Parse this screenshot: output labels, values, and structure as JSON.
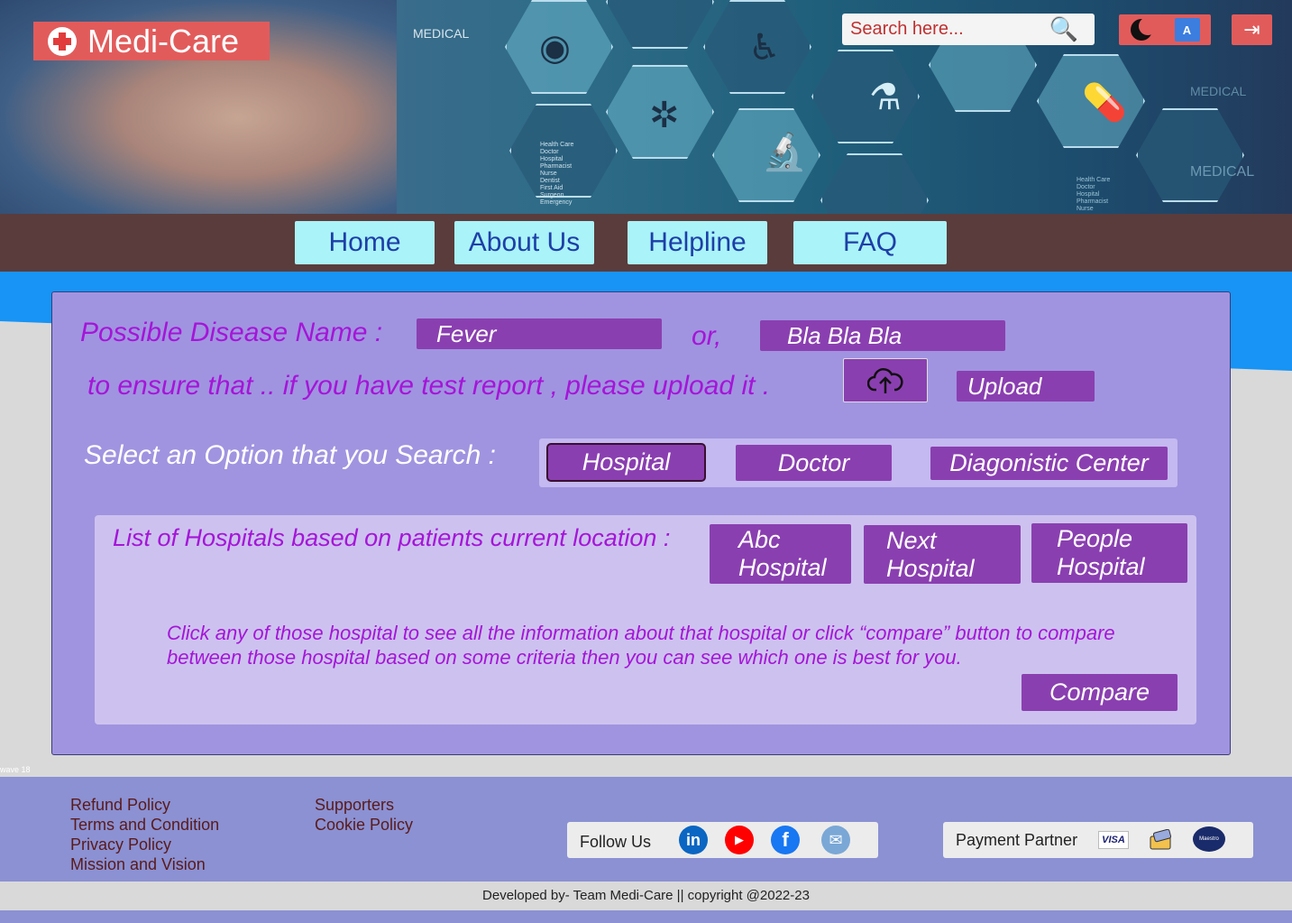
{
  "header": {
    "brand": "Medi-Care",
    "banner_tags": {
      "medical_1": "MEDICAL",
      "medical_2": "MEDICAL",
      "medical_3": "MEDICAL"
    },
    "banner_list_1": "Health Care\nDoctor\nHospital\nPharmacist\nNurse\nDentist\nFirst Aid\nSurgeon\nEmergency",
    "banner_list_2": "Health Care\nDoctor\nHospital\nPharmacist\nNurse",
    "search": {
      "placeholder": "Search here..."
    },
    "translate_label": "A"
  },
  "nav": {
    "items": [
      "Home",
      "About Us",
      "Helpline",
      "FAQ"
    ]
  },
  "form": {
    "disease_label": "Possible Disease Name :",
    "disease_value": "Fever",
    "or_label": "or,",
    "disease_alt_value": "Bla Bla Bla",
    "upload_prompt": "to ensure that .. if you have test report , please upload it .",
    "upload_button": "Upload",
    "select_label": "Select an Option that you Search :",
    "options": [
      "Hospital",
      "Doctor",
      "Diagonistic Center"
    ],
    "selected_option": "Hospital"
  },
  "results": {
    "label": "List of Hospitals based on patients current location :",
    "hospitals": [
      "Abc\nHospital",
      "Next\nHospital",
      "People\nHospital"
    ],
    "description": "Click any of those hospital to see all the information about that hospital or click “compare” button to compare between those hospital based on some criteria then you can see which one is best for you.",
    "compare_button": "Compare"
  },
  "wave_label": "wave 18",
  "footer": {
    "links_col1": [
      "Refund Policy",
      "Terms and Condition",
      "Privacy Policy",
      "Mission and Vision"
    ],
    "links_col2": [
      "Supporters",
      "Cookie Policy"
    ],
    "follow_label": "Follow Us",
    "social": [
      {
        "name": "linkedin",
        "glyph": "in",
        "color": "#0a66c2"
      },
      {
        "name": "youtube",
        "glyph": "▶",
        "color": "#ff0000"
      },
      {
        "name": "facebook",
        "glyph": "f",
        "color": "#1877f2"
      },
      {
        "name": "email",
        "glyph": "✉",
        "color": "#7aa7d6"
      }
    ],
    "payment_label": "Payment Partner",
    "payment_visa": "VISA",
    "payment_maestro": "Maestro",
    "copyright": "Developed by- Team Medi-Care || copyright @2022-23"
  },
  "colors": {
    "accent": "#8a3fb0",
    "nav_bg": "#5a3c3c",
    "nav_btn": "#aaf3f8",
    "logo": "#e25b5b",
    "panel": "#a094e0"
  }
}
